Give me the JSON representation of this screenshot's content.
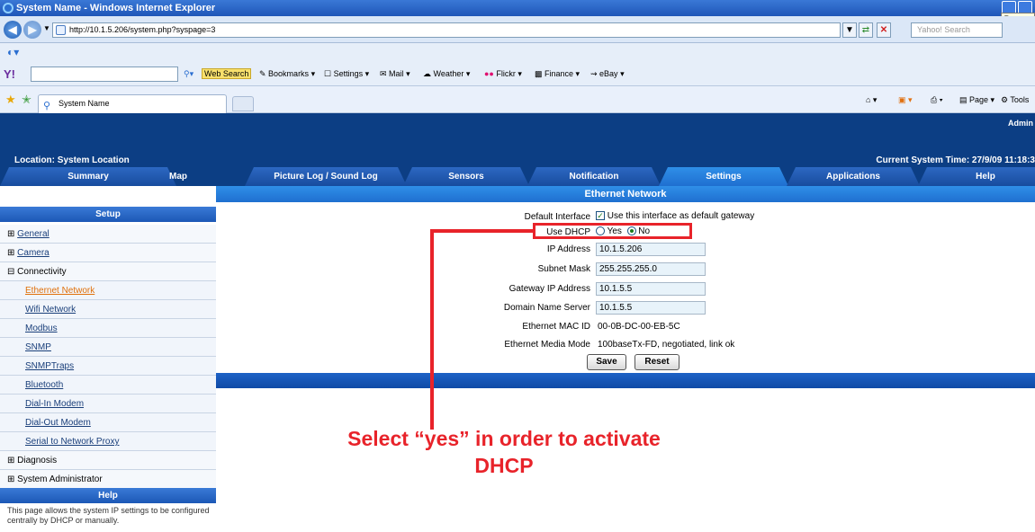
{
  "window": {
    "title": "System Name - Windows Internet Explorer",
    "tooltip": "Restore"
  },
  "browser": {
    "url": "http://10.1.5.206/system.php?syspage=3",
    "search_placeholder": "Yahoo! Search",
    "toolbar": {
      "web_search": "Web Search",
      "bookmarks": "Bookmarks",
      "settings": "Settings",
      "mail": "Mail",
      "weather": "Weather",
      "flickr": "Flickr",
      "finance": "Finance",
      "ebay": "eBay"
    },
    "tab_title": "System Name",
    "commands": {
      "page": "Page",
      "tools": "Tools"
    }
  },
  "header": {
    "admin": "Admin",
    "location": "Location: System Location",
    "system_time": "Current System Time: 27/9/09 11:18:3"
  },
  "nav": {
    "tabs": [
      "Summary",
      "Map",
      "Picture Log / Sound Log",
      "Sensors",
      "Notification",
      "Settings",
      "Applications",
      "Help"
    ],
    "active": "Settings"
  },
  "sidebar": {
    "setup_title": "Setup",
    "general": "General",
    "camera": "Camera",
    "connectivity": "Connectivity",
    "connectivity_items": [
      "Ethernet Network",
      "Wifi Network",
      "Modbus",
      "SNMP",
      "SNMPTraps",
      "Bluetooth",
      "Dial-In Modem",
      "Dial-Out Modem",
      "Serial to Network Proxy"
    ],
    "diagnosis": "Diagnosis",
    "system_admin": "System Administrator",
    "help_title": "Help",
    "help_text": "This page allows the system IP settings to be configured centrally by DHCP or manually."
  },
  "ethernet": {
    "heading": "Ethernet Network",
    "default_interface_label": "Default Interface",
    "default_interface_text": "Use this interface as default gateway",
    "default_interface_checked": true,
    "use_dhcp_label": "Use DHCP",
    "dhcp_yes": "Yes",
    "dhcp_no": "No",
    "dhcp_selected": "No",
    "ip_label": "IP Address",
    "ip_value": "10.1.5.206",
    "subnet_label": "Subnet Mask",
    "subnet_value": "255.255.255.0",
    "gateway_label": "Gateway IP Address",
    "gateway_value": "10.1.5.5",
    "dns_label": "Domain Name Server",
    "dns_value": "10.1.5.5",
    "mac_label": "Ethernet MAC ID",
    "mac_value": "00-0B-DC-00-EB-5C",
    "media_label": "Ethernet Media Mode",
    "media_value": "100baseTx-FD, negotiated, link ok",
    "save": "Save",
    "reset": "Reset"
  },
  "annotation": {
    "line1": "Select “yes” in order to activate",
    "line2": "DHCP",
    "color": "#e8232a"
  }
}
